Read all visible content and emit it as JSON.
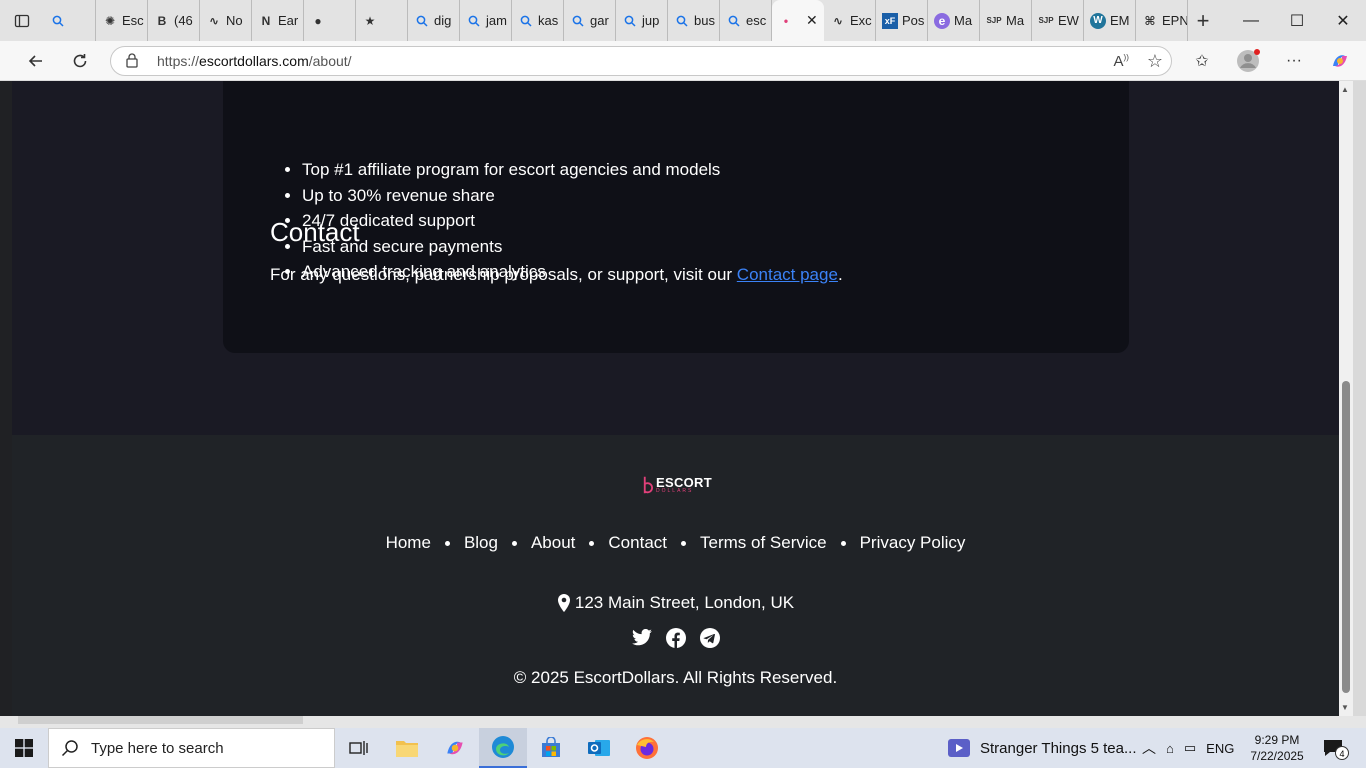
{
  "browser": {
    "tabs": [
      {
        "label": "",
        "icon": "search-icon",
        "active": false
      },
      {
        "label": "Esc",
        "icon": "openai-icon",
        "active": false
      },
      {
        "label": "(46",
        "icon": "b-icon",
        "active": false
      },
      {
        "label": "No",
        "icon": "chart-icon",
        "active": false
      },
      {
        "label": "Ear",
        "icon": "n-icon",
        "active": false
      },
      {
        "label": "",
        "icon": "globe-icon",
        "active": false
      },
      {
        "label": "",
        "icon": "badge-icon",
        "active": false
      },
      {
        "label": "dig",
        "icon": "search-icon",
        "active": false
      },
      {
        "label": "jam",
        "icon": "search-icon",
        "active": false
      },
      {
        "label": "kas",
        "icon": "search-icon",
        "active": false
      },
      {
        "label": "gar",
        "icon": "search-icon",
        "active": false
      },
      {
        "label": "jup",
        "icon": "search-icon",
        "active": false
      },
      {
        "label": "bus",
        "icon": "search-icon",
        "active": false
      },
      {
        "label": "esc",
        "icon": "search-icon",
        "active": false
      },
      {
        "label": "",
        "icon": "escort-favicon",
        "active": true
      },
      {
        "label": "Exc",
        "icon": "chart-icon",
        "active": false
      },
      {
        "label": "Pos",
        "icon": "xf-icon",
        "active": false
      },
      {
        "label": "Ma",
        "icon": "e-icon",
        "active": false
      },
      {
        "label": "Ma",
        "icon": "sjp-icon",
        "active": false
      },
      {
        "label": "EW",
        "icon": "sjp-icon",
        "active": false
      },
      {
        "label": "EM",
        "icon": "wordpress-icon",
        "active": false
      },
      {
        "label": "EPN",
        "icon": "epn-icon",
        "active": false
      }
    ],
    "url_base": "https://",
    "url_host": "escortdollars.com",
    "url_path": "/about/"
  },
  "page": {
    "features": [
      "Top #1 affiliate program for escort agencies and models",
      "Up to 30% revenue share",
      "24/7 dedicated support",
      "Fast and secure payments",
      "Advanced tracking and analytics"
    ],
    "contact_heading": "Contact",
    "contact_text": "For any questions, partnership proposals, or support, visit our ",
    "contact_link": "Contact page",
    "contact_end": "."
  },
  "footer": {
    "logo_main": "ESCORT",
    "logo_sub": "DOLLARS",
    "nav": [
      "Home",
      "Blog",
      "About",
      "Contact",
      "Terms of Service",
      "Privacy Policy"
    ],
    "address": "123 Main Street, London, UK",
    "copyright": "© 2025 EscortDollars. All Rights Reserved.",
    "accent_color": "#e0407a"
  },
  "taskbar": {
    "search_placeholder": "Type here to search",
    "notification": "Stranger Things 5 tea...",
    "language": "ENG",
    "time": "9:29 PM",
    "date": "7/22/2025",
    "notification_count": "4"
  }
}
